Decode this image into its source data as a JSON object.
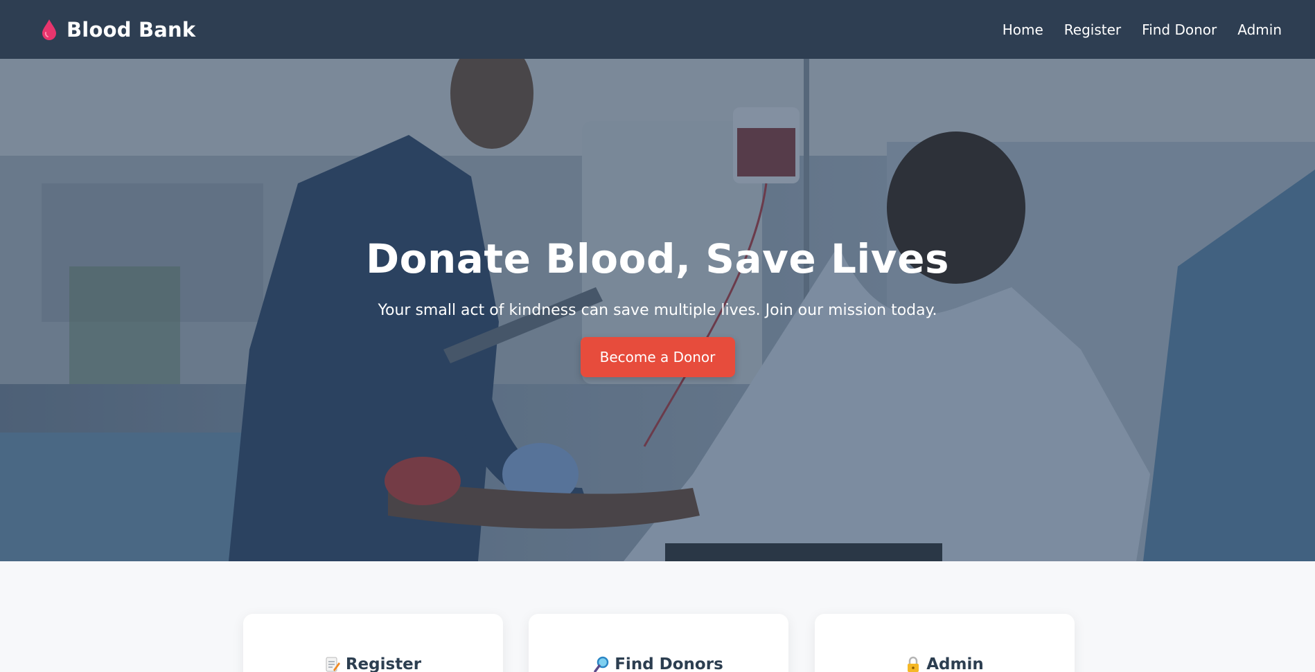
{
  "brand": {
    "name": "Blood Bank",
    "icon": "blood-drop-icon",
    "icon_color": "#e8356d"
  },
  "nav": {
    "items": [
      {
        "label": "Home"
      },
      {
        "label": "Register"
      },
      {
        "label": "Find Donor"
      },
      {
        "label": "Admin"
      }
    ]
  },
  "hero": {
    "title": "Donate Blood, Save Lives",
    "subtitle": "Your small act of kindness can save multiple lives. Join our mission today.",
    "cta_label": "Become a Donor",
    "cta_color": "#e74c3c"
  },
  "cards": [
    {
      "title": "Register",
      "icon": "memo-icon"
    },
    {
      "title": "Find Donors",
      "icon": "magnifier-icon"
    },
    {
      "title": "Admin",
      "icon": "lock-icon"
    }
  ],
  "colors": {
    "navbar": "#2e3e52",
    "text_dark": "#2c3e50",
    "page_bg": "#f7f8fa"
  }
}
